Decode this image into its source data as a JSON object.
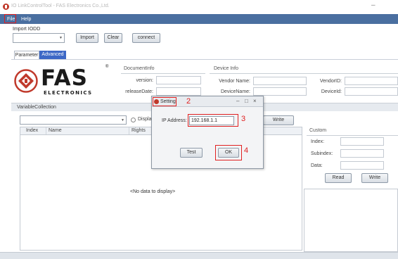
{
  "window": {
    "title": "IO LinkControlTool - FAS Electronics Co.,Ltd."
  },
  "menu": {
    "file": "File",
    "help": "Help"
  },
  "import": {
    "label": "Import IODD",
    "import_btn": "Import",
    "clear_btn": "Clear",
    "connect_btn": "connect"
  },
  "tabs": [
    {
      "label": "Parameter"
    },
    {
      "label": "Advanced"
    }
  ],
  "logo": {
    "letters": "FAS",
    "sub": "ELECTRONICS",
    "reg": "®"
  },
  "document_info": {
    "title": "DocumentInfo",
    "version_label": "version:",
    "release_label": "releaseDate:"
  },
  "device_info": {
    "title": "Device Info",
    "vendor_name_label": "Vendor Name:",
    "device_name_label": "DeviceName:",
    "vendor_id_label": "VendorID:",
    "device_id_label": "DeviceId:"
  },
  "variable_collection": {
    "title": "VariableCollection",
    "display_label": "Display",
    "write_btn": "Write",
    "columns": [
      "Index",
      "Name",
      "Rights"
    ],
    "empty_text": "<No data to display>"
  },
  "custom": {
    "title": "Custom",
    "index_label": "Index:",
    "subindex_label": "Subindex:",
    "data_label": "Data:",
    "read_btn": "Read",
    "write_btn": "Write"
  },
  "dialog": {
    "title": "Setting",
    "ip_label": "IP Address:",
    "ip_value": "192.168.1.1",
    "test_btn": "Test",
    "ok_btn": "OK"
  },
  "annotations": {
    "step2": "2",
    "step3": "3",
    "step4": "4"
  },
  "colors": {
    "menubar": "#4a6fa0",
    "tab_active": "#3d68c6",
    "annotation": "#e02020",
    "brand_red": "#c0392b"
  }
}
